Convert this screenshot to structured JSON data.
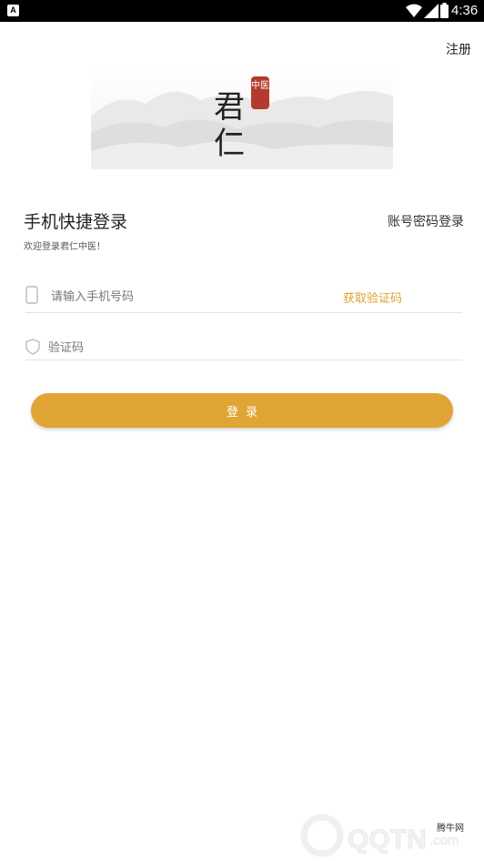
{
  "status_bar": {
    "app_badge": "A",
    "time": "4:36",
    "icons": [
      "wifi-icon",
      "signal-icon",
      "battery-icon"
    ]
  },
  "header": {
    "register_label": "注册"
  },
  "logo": {
    "char1": "君",
    "char2": "仁",
    "seal_text": "中医"
  },
  "login": {
    "title": "手机快捷登录",
    "account_login_label": "账号密码登录",
    "welcome": "欢迎登录君仁中医！",
    "phone_placeholder": "请输入手机号码",
    "phone_value": "",
    "get_code_label": "获取验证码",
    "code_placeholder": "验证码",
    "code_value": "",
    "submit_label": "登录"
  },
  "watermark": {
    "site_name": "腾牛网",
    "logo_text": "QQTN.com"
  },
  "colors": {
    "accent": "#e0a534",
    "accent_text": "#dba32f",
    "seal": "#b53a2e",
    "status_bar": "#000000"
  }
}
